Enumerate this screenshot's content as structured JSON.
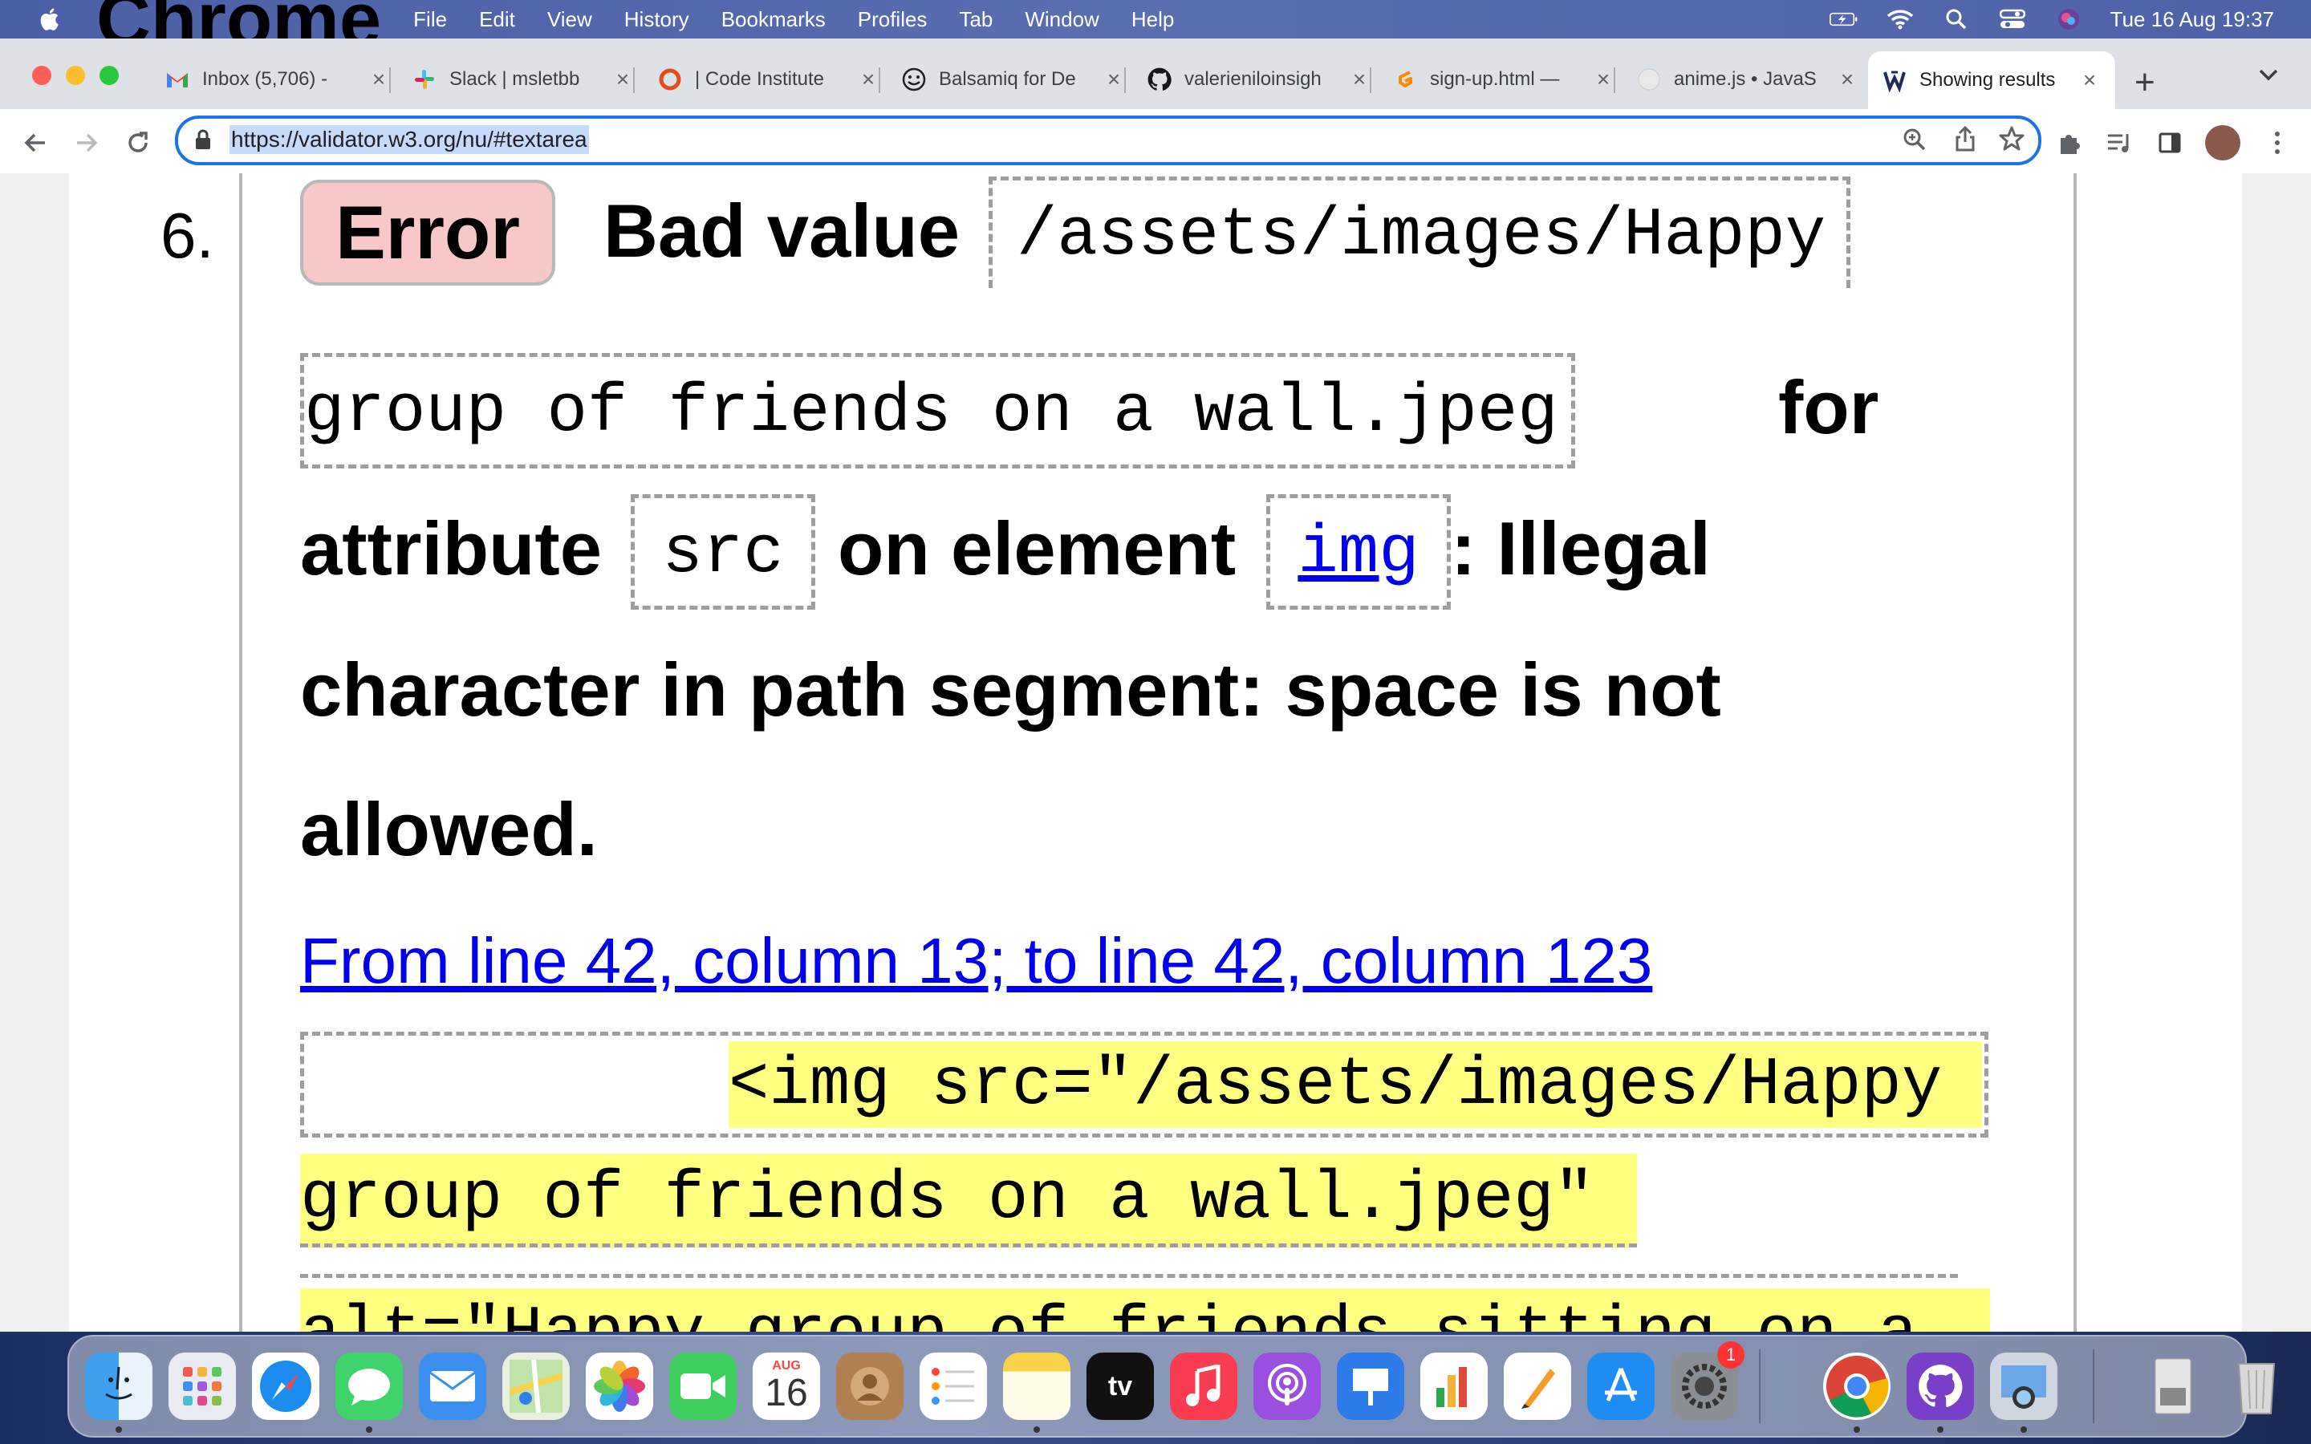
{
  "menubar": {
    "items": [
      "Chrome",
      "File",
      "Edit",
      "View",
      "History",
      "Bookmarks",
      "Profiles",
      "Tab",
      "Window",
      "Help"
    ],
    "datetime": "Tue 16 Aug  19:37"
  },
  "tabs": [
    {
      "title": "Inbox (5,706) -",
      "icon": "gmail-icon"
    },
    {
      "title": "Slack | msletbb",
      "icon": "slack-icon"
    },
    {
      "title": "| Code Institute",
      "icon": "code-institute-icon"
    },
    {
      "title": "Balsamiq for De",
      "icon": "balsamiq-icon"
    },
    {
      "title": "valerieniloinsigh",
      "icon": "github-icon"
    },
    {
      "title": "sign-up.html —",
      "icon": "gitpod-icon"
    },
    {
      "title": "anime.js • JavaS",
      "icon": "anime-icon"
    },
    {
      "title": "Showing results",
      "icon": "validator-icon",
      "active": true
    }
  ],
  "toolbar": {
    "url": "https://validator.w3.org/nu/#textarea"
  },
  "message": {
    "number": "6.",
    "badge": "Error",
    "bad_value": "Bad value",
    "value_part1": "/assets/images/Happy",
    "value_part2": "group of friends on a wall.jpeg",
    "for": "for",
    "attribute": "attribute",
    "attr_name": "src",
    "on_element": "on element",
    "element_name": "img",
    "illegal": ": Illegal",
    "line3": "character in path segment: space is not",
    "line4": "allowed.",
    "location": "From line 42, column 13; to line 42, column 123",
    "extract": {
      "line1": "<img src=\"/assets/images/Happy",
      "line2": "group of friends on a wall.jpeg\"",
      "line3": "alt=\"Happy group of friends sitting on a"
    }
  },
  "dock": {
    "calendar_month": "AUG",
    "calendar_day": "16",
    "settings_badge": "1",
    "tv_label": "tv",
    "apps": [
      "finder",
      "launchpad",
      "safari",
      "messages",
      "mail",
      "maps",
      "photos",
      "facetime",
      "calendar",
      "contacts",
      "reminders",
      "notes",
      "tv",
      "music",
      "podcasts",
      "keynote",
      "numbers",
      "pages",
      "app-store",
      "system-preferences",
      "chrome",
      "github-desktop",
      "preview",
      "downloads",
      "trash"
    ]
  },
  "colors": {
    "error_badge": "#f8c7c7",
    "highlight": "#ffff80",
    "link": "#0000ee",
    "omnibox_focus": "#1a73e8"
  }
}
